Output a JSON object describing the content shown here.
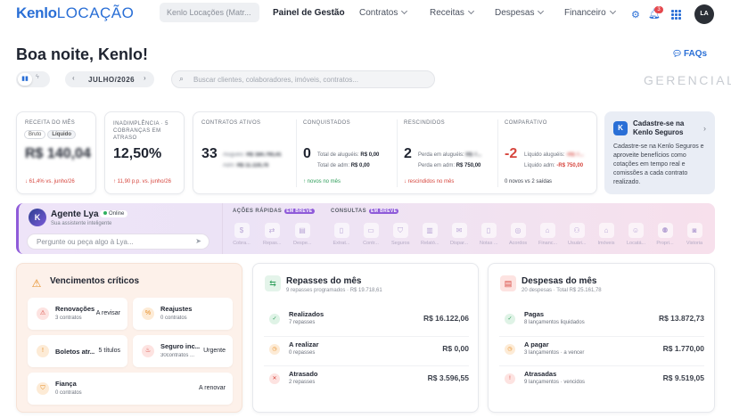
{
  "brand": {
    "logo_a": "Kenlo",
    "logo_b": "LOCAÇÃO"
  },
  "nav": {
    "tenant": "Kenlo Locações (Matr...",
    "links": [
      {
        "label": "Painel de Gestão",
        "active": true
      },
      {
        "label": "Contratos"
      },
      {
        "label": "Receitas"
      },
      {
        "label": "Despesas"
      },
      {
        "label": "Financeiro"
      }
    ],
    "notifications": "3",
    "avatar": "LA"
  },
  "header": {
    "greeting": "Boa noite, Kenlo!",
    "faqs": "FAQs",
    "month": "JULHO/2026",
    "search_placeholder": "Buscar clientes, colaboradores, imóveis, contratos...",
    "watermark": "GERENCIAL"
  },
  "kpi": {
    "receita": {
      "label": "RECEITA DO MÊS",
      "tab_bruto": "Bruto",
      "tab_liquido": "Líquido",
      "value": "R$ 140,04",
      "delta": "↓ 61,4% vs. junho/26"
    },
    "inadimplencia": {
      "label": "INADIMPLÊNCIA · 5 COBRANÇAS EM ATRASO",
      "value": "12,50%",
      "delta": "↑ 11,90 p.p. vs. junho/26"
    },
    "ativos": {
      "label": "CONTRATOS ATIVOS",
      "value": "33",
      "l1": "Aluguéis:",
      "v1": "R$ 184.793,41",
      "l2": "Adm:",
      "v2": "R$ 11.119,76"
    },
    "conquistados": {
      "label": "CONQUISTADOS",
      "value": "0",
      "l1": "Total de aluguéis:",
      "v1": "R$ 0,00",
      "l2": "Total de adm:",
      "v2": "R$ 0,00",
      "foot": "↑ novos no mês"
    },
    "rescindidos": {
      "label": "RESCINDIDOS",
      "value": "2",
      "l1": "Perda em aluguéis:",
      "v1": "R$ 7...",
      "l2": "Perda em adm:",
      "v2": "R$ 750,00",
      "foot": "↓ rescindidos no mês"
    },
    "comparativo": {
      "label": "COMPARATIVO",
      "value": "-2",
      "l1": "Líquido aluguéis:",
      "v1": "-R$ 7...",
      "l2": "Líquido adm:",
      "v2": "-R$ 750,00",
      "foot": "0 novos vs 2 saídas"
    }
  },
  "promo": {
    "title": "Cadastre-se na Kenlo Seguros",
    "body": "Cadastre-se na Kenlo Seguros e aproveite benefícios como cotações em tempo real e comissões a cada contrato realizado."
  },
  "agent": {
    "name": "Agente Lya",
    "status": "Online",
    "subtitle": "Sua assistente inteligente",
    "ask_placeholder": "Pergunte ou peça algo à Lya...",
    "quick_title": "AÇÕES RÁPIDAS",
    "quick_badge": "EM BREVE",
    "quick": [
      "Cobra...",
      "Repas...",
      "Despe..."
    ],
    "consult_title": "CONSULTAS",
    "consult_badge": "EM BREVE",
    "consult": [
      "Extrat...",
      "Contr...",
      "Seguros",
      "Relató...",
      "Dispar...",
      "Notas ...",
      "Acordos",
      "Financ...",
      "Usuári...",
      "Imóveis",
      "Locatá...",
      "Propri...",
      "Vistoria"
    ]
  },
  "vencimentos": {
    "title": "Vencimentos críticos",
    "items": [
      {
        "title": "Renovações",
        "sub": "3 contratos",
        "action": "A revisar"
      },
      {
        "title": "Reajustes",
        "sub": "0 contratos",
        "action": ""
      },
      {
        "title": "Boletos atr...",
        "sub": "",
        "action": "5 títulos"
      },
      {
        "title": "Seguro inc...",
        "sub": "30contratos ...",
        "action": "Urgente"
      },
      {
        "title": "Fiança",
        "sub": "0 contratos",
        "action": "A renovar"
      }
    ]
  },
  "repasses": {
    "title": "Repasses do mês",
    "sub": "9 repasses programados · R$ 19.718,61",
    "rows": [
      {
        "title": "Realizados",
        "sub": "7 repasses",
        "value": "R$ 16.122,06"
      },
      {
        "title": "A realizar",
        "sub": "0 repasses",
        "value": "R$ 0,00"
      },
      {
        "title": "Atrasado",
        "sub": "2 repasses",
        "value": "R$ 3.596,55"
      }
    ]
  },
  "despesas": {
    "title": "Despesas do mês",
    "sub": "20 despesas · Total R$ 25.161,78",
    "rows": [
      {
        "title": "Pagas",
        "sub": "8 lançamentos liquidados",
        "value": "R$ 13.872,73"
      },
      {
        "title": "A pagar",
        "sub": "3 lançamentos · a vencer",
        "value": "R$ 1.770,00"
      },
      {
        "title": "Atrasadas",
        "sub": "9 lançamentos · vencidos",
        "value": "R$ 9.519,05"
      }
    ]
  },
  "colors": {
    "accent": "#2a6fd6",
    "agent_purple": "#8f5bd9",
    "danger": "#d6453d",
    "success": "#2f9e5b",
    "warn_bg": "#fdf1ea"
  }
}
